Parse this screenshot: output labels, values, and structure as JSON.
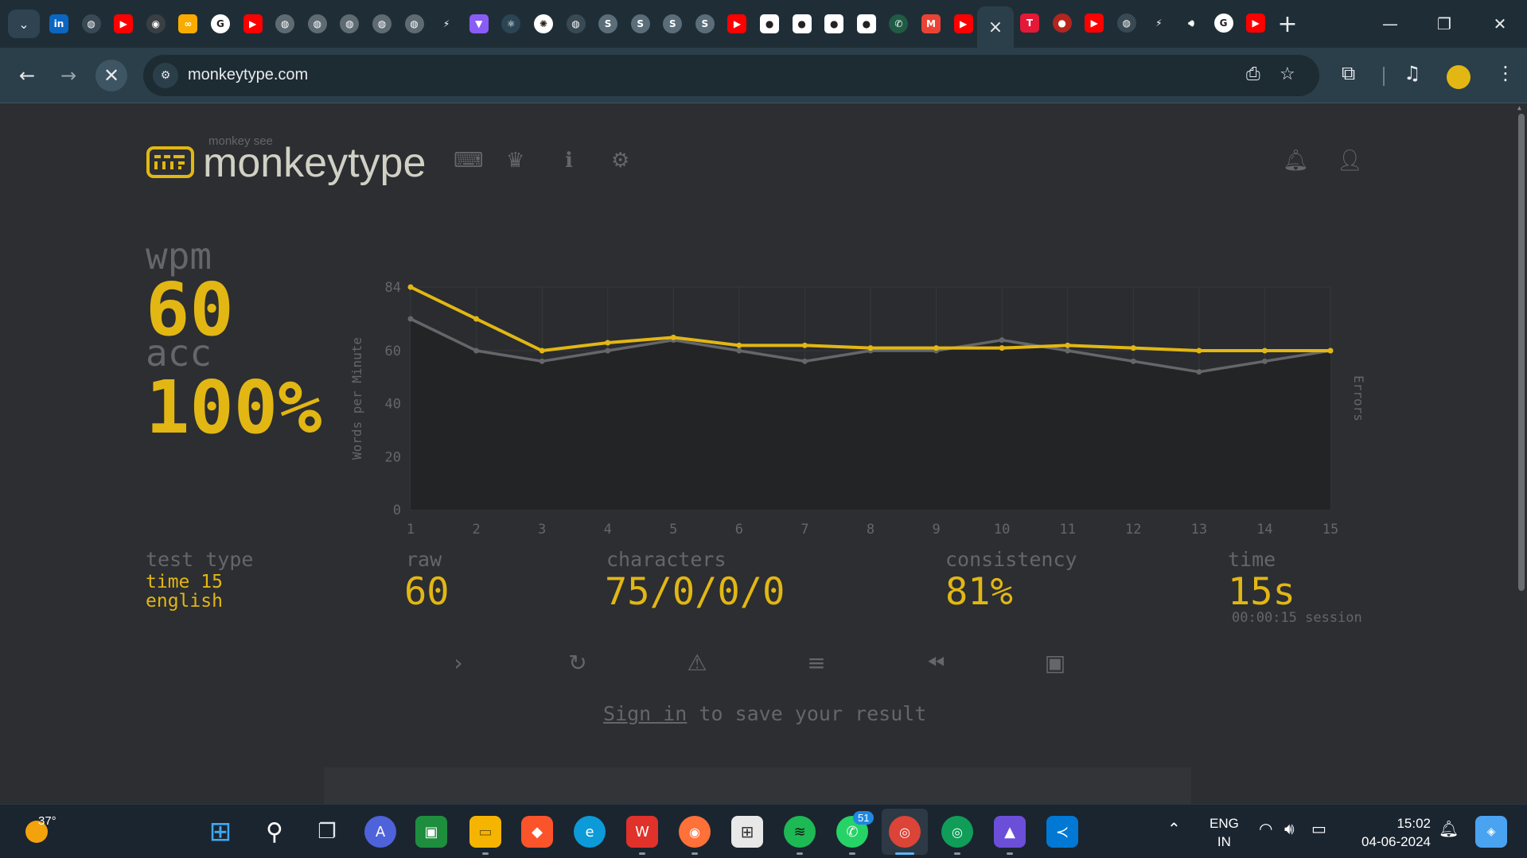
{
  "browser": {
    "tab_favicons": [
      "linkedin",
      "web-app",
      "youtube",
      "github",
      "colab",
      "google",
      "youtube",
      "globe",
      "globe",
      "globe",
      "globe",
      "globe",
      "stackblitz",
      "vite",
      "react",
      "chatgpt",
      "web-app",
      "sap",
      "sap",
      "sap",
      "sap",
      "youtube",
      "monkey",
      "monkey",
      "monkey",
      "monkey",
      "whatsapp",
      "gmail",
      "youtube"
    ],
    "tab_favicons_after_active": [
      "tesla",
      "app-red",
      "youtube",
      "web-app",
      "stackblitz",
      "audio",
      "google",
      "youtube"
    ],
    "active_tab_close": "×",
    "new_tab": "+",
    "url": "monkeytype.com",
    "profile_color": "#e2b714"
  },
  "site": {
    "logo_sub": "monkey see",
    "logo_text": "monkeytype",
    "nav_icons": [
      "keyboard-icon",
      "crown-icon",
      "info-icon",
      "gear-icon"
    ],
    "right_icons": [
      "bell-icon",
      "account-icon"
    ]
  },
  "result": {
    "wpm_label": "wpm",
    "wpm": "60",
    "acc_label": "acc",
    "acc": "100%",
    "test_type_label": "test type",
    "test_type_line1": "time 15",
    "test_type_line2": "english",
    "raw_label": "raw",
    "raw": "60",
    "characters_label": "characters",
    "characters": "75/0/0/0",
    "consistency_label": "consistency",
    "consistency": "81%",
    "time_label": "time",
    "time": "15s",
    "session": "00:00:15 session",
    "signin_link": "Sign in",
    "signin_rest": " to save your result"
  },
  "chart_data": {
    "type": "line",
    "x": [
      1,
      2,
      3,
      4,
      5,
      6,
      7,
      8,
      9,
      10,
      11,
      12,
      13,
      14,
      15
    ],
    "series": [
      {
        "name": "wpm",
        "color": "#e2b714",
        "values": [
          84,
          72,
          60,
          63,
          65,
          62,
          62,
          61,
          61,
          61,
          62,
          61,
          60,
          60,
          60
        ]
      },
      {
        "name": "raw",
        "color": "#646669",
        "values": [
          72,
          60,
          56,
          60,
          64,
          60,
          56,
          60,
          60,
          64,
          60,
          56,
          52,
          56,
          60
        ]
      }
    ],
    "ylabel": "Words per Minute",
    "y2label": "Errors",
    "yticks": [
      "0",
      "20",
      "40",
      "60",
      "84"
    ],
    "ytick_values": [
      0,
      20,
      40,
      60,
      84
    ],
    "ylim": [
      0,
      84
    ],
    "grid": true
  },
  "taskbar": {
    "weather_temp": "37°",
    "apps": [
      "start",
      "search",
      "task-view",
      "app-a",
      "classroom",
      "file-explorer",
      "brave",
      "edge",
      "wps-office",
      "firefox",
      "microsoft-store",
      "spotify",
      "whatsapp",
      "chrome",
      "chrome-profile",
      "photos",
      "vscode"
    ],
    "whatsapp_badge": "51",
    "lang_line1": "ENG",
    "lang_line2": "IN",
    "time": "15:02",
    "date": "04-06-2024"
  }
}
